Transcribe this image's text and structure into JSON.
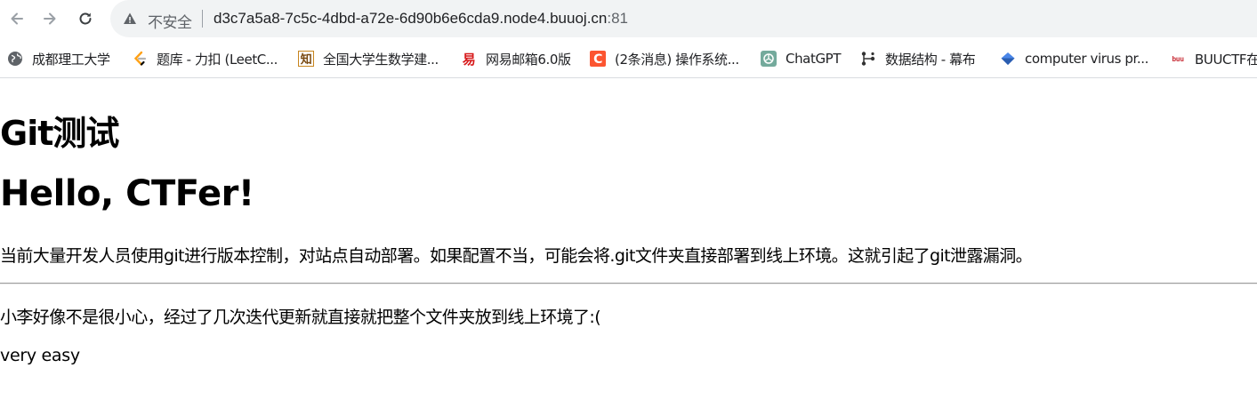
{
  "browser": {
    "security_label": "不安全",
    "url_host": "d3c7a5a8-7c5c-4dbd-a72e-6d90b6e6cda9.node4.buuoj.cn",
    "url_port": ":81",
    "bookmarks": [
      {
        "label": "成都理工大学",
        "icon": "globe-icon"
      },
      {
        "label": "题库 - 力扣 (LeetC...",
        "icon": "leetcode-icon"
      },
      {
        "label": "全国大学生数学建...",
        "icon": "zhi-icon"
      },
      {
        "label": "网易邮箱6.0版",
        "icon": "netease-mail-icon"
      },
      {
        "label": "(2条消息) 操作系统...",
        "icon": "csdn-icon"
      },
      {
        "label": "ChatGPT",
        "icon": "chatgpt-icon"
      },
      {
        "label": "数据结构 - 幕布",
        "icon": "mubu-icon"
      },
      {
        "label": "computer virus pr...",
        "icon": "diamond-icon"
      },
      {
        "label": "BUUCTF在",
        "icon": "buuctf-icon"
      }
    ]
  },
  "page": {
    "heading_git": "Git测试",
    "heading_hello": "Hello, CTFer!",
    "description": "当前大量开发人员使用git进行版本控制，对站点自动部署。如果配置不当，可能会将.git文件夹直接部署到线上环境。这就引起了git泄露漏洞。",
    "note": "小李好像不是很小心，经过了几次迭代更新就直接就把整个文件夹放到线上环境了:(",
    "hint": "very easy"
  }
}
